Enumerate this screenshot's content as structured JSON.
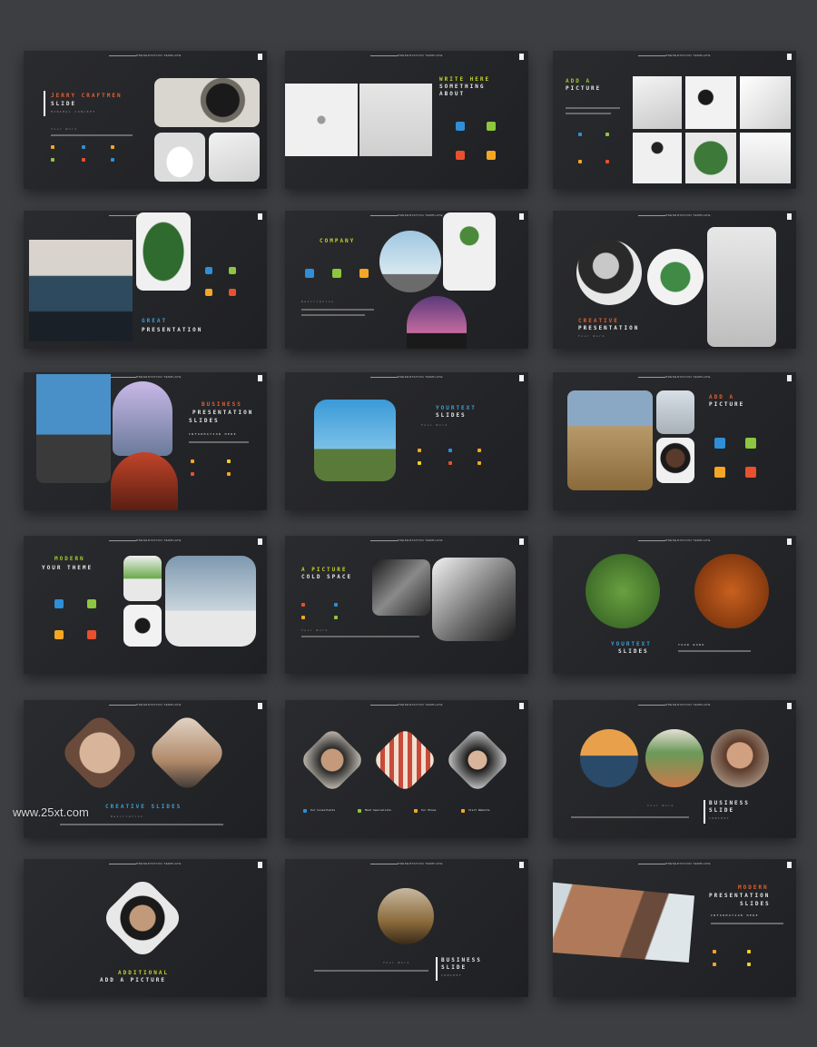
{
  "watermark": "www.25xt.com",
  "slide_header": "PRESENTATION TEMPLATE",
  "slides": {
    "s1": {
      "title_a": "JERRY CRAFTMEN",
      "title_b": "SLIDE",
      "sub": "MINIMAL CONCEPT",
      "section": "Your Work"
    },
    "s2": {
      "title_a": "WRITE HERE",
      "title_b": "SOMETHING",
      "title_c": "ABOUT"
    },
    "s3": {
      "title_a": "ADD A",
      "title_b": "PICTURE"
    },
    "s4": {
      "title_a": "GREAT",
      "title_b": "PRESENTATION"
    },
    "s5": {
      "title": "COMPANY",
      "section": "Description"
    },
    "s6": {
      "title_a": "CREATIVE",
      "title_b": "PRESENTATION",
      "section": "Your Work"
    },
    "s7": {
      "title_a": "BUSINESS",
      "title_b": "PRESENTATION",
      "title_c": "SLIDES",
      "section": "INFORMATION HERE"
    },
    "s8": {
      "title_a": "YOURTEXT",
      "title_b": "SLIDES",
      "section": "Your Work"
    },
    "s9": {
      "title_a": "ADD A",
      "title_b": "PICTURE"
    },
    "s10": {
      "title_a": "MODERN",
      "title_b": "YOUR THEME"
    },
    "s11": {
      "title_a": "A PICTURE",
      "title_b": "COLD SPACE",
      "section": "Your Work"
    },
    "s12": {
      "title_a": "YOURTEXT",
      "title_b": "SLIDES",
      "section": "YOUR WORK"
    },
    "s13": {
      "title": "CREATIVE SLIDES",
      "section": "Description"
    },
    "s14": {
      "items": [
        "Our Consultants",
        "Meet Specialists",
        "Our Phone",
        "Visit Website"
      ]
    },
    "s15": {
      "title_a": "BUSINESS",
      "title_b": "SLIDE",
      "title_c": "CONCEPT",
      "section": "Your Work"
    },
    "s16": {
      "title_a": "ADDITIONAL",
      "title_b": "ADD A PICTURE"
    },
    "s17": {
      "title_a": "BUSINESS",
      "title_b": "SLIDE",
      "title_c": "CONCEPT",
      "section": "Your Work"
    },
    "s18": {
      "title_a": "MODERN",
      "title_b": "PRESENTATION",
      "title_c": "SLIDES",
      "section": "INFORMATION HERE"
    }
  }
}
